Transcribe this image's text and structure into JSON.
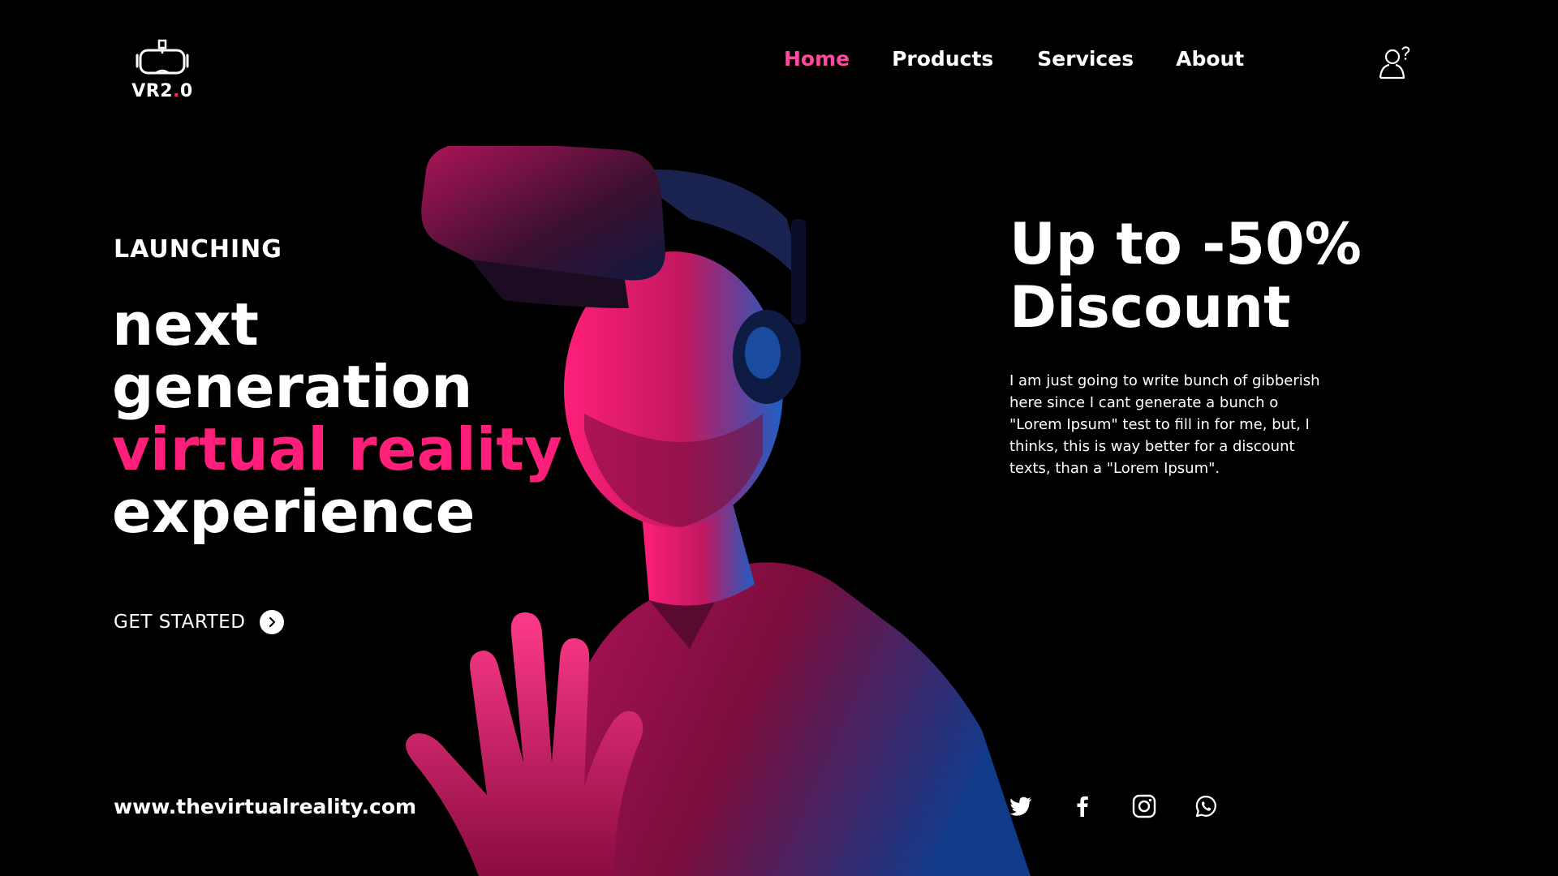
{
  "brand": {
    "name_main": "VR2",
    "name_dot": ".",
    "name_tail": "0"
  },
  "nav": {
    "items": [
      {
        "label": "Home",
        "active": true
      },
      {
        "label": "Products",
        "active": false
      },
      {
        "label": "Services",
        "active": false
      },
      {
        "label": "About",
        "active": false
      }
    ]
  },
  "hero": {
    "kicker": "LAUNCHING",
    "headline": [
      "next",
      "generation",
      "virtual reality",
      "experience"
    ],
    "cta_label": "GET STARTED"
  },
  "website": "www.thevirtualreality.com",
  "discount": {
    "title": [
      "Up to -50%",
      "Discount"
    ],
    "text": "I am just going to write bunch of gibberish here since I cant generate a bunch o \"Lorem Ipsum\" test to fill in for me, but, I thinks, this is way better for a discount texts, than a \"Lorem Ipsum\"."
  },
  "social": [
    "twitter-icon",
    "facebook-icon",
    "instagram-icon",
    "whatsapp-icon"
  ],
  "colors": {
    "background": "#000000",
    "accent": "#ff1f7a",
    "nav_active": "#ff4aa0",
    "text": "#ffffff",
    "blue_light": "#1e6fd0"
  }
}
